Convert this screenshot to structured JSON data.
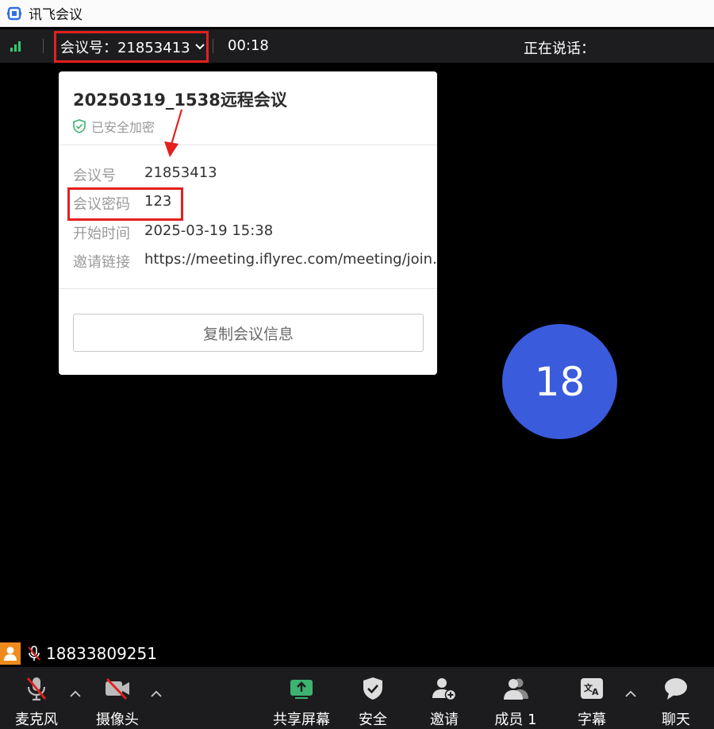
{
  "window": {
    "title": "讯飞会议"
  },
  "topbar": {
    "meeting_id_label": "会议号：21853413",
    "timer": "00:18",
    "speaking_label": "正在说话："
  },
  "popover": {
    "title": "20250319_1538远程会议",
    "secure_text": "已安全加密",
    "rows": [
      {
        "label": "会议号",
        "value": "21853413"
      },
      {
        "label": "会议密码",
        "value": "123"
      },
      {
        "label": "开始时间",
        "value": "2025-03-19 15:38"
      },
      {
        "label": "邀请链接",
        "value": "https://meeting.iflyrec.com/meeting/join..."
      }
    ],
    "copy_button": "复制会议信息"
  },
  "avatar": {
    "text": "18",
    "color": "#3a5bdc"
  },
  "participant": {
    "name": "18833809251"
  },
  "toolbar": {
    "mic": "麦克风",
    "camera": "摄像头",
    "share": "共享屏幕",
    "security": "安全",
    "invite": "邀请",
    "members": "成员 1",
    "subtitles": "字幕",
    "chat": "聊天"
  },
  "colors": {
    "highlight": "#e3201e",
    "signal": "#2ecc71",
    "host_badge": "#f08a1c",
    "share_green": "#3cb371"
  }
}
